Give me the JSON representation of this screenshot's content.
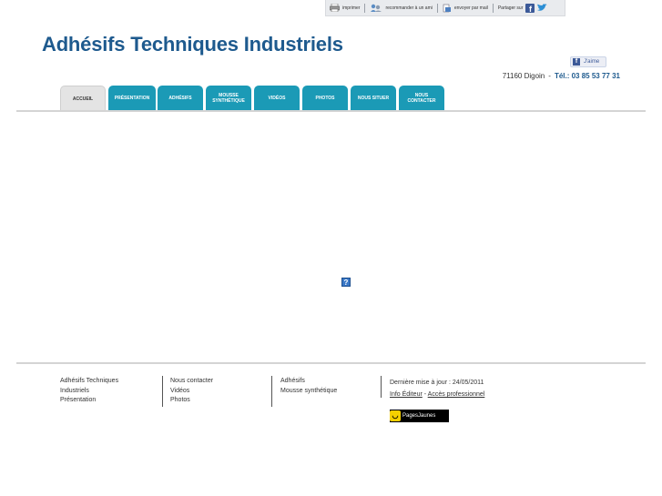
{
  "toolbar": {
    "print_label": "imprimer",
    "recommend_label": "recommander à un ami",
    "email_label": "envoyer par mail",
    "share_label": "Partager sur"
  },
  "header": {
    "title": "Adhésifs Techniques Industriels",
    "like_label": "J'aime",
    "city": "71160 Digoin",
    "separator": "-",
    "phone": "Tél.: 03 85 53 77 31"
  },
  "nav": {
    "tabs": [
      {
        "label": "Accueil"
      },
      {
        "label": "Présentation"
      },
      {
        "label": "Adhésifs"
      },
      {
        "label": "Mousse synthétique"
      },
      {
        "label": "Vidéos"
      },
      {
        "label": "Photos"
      },
      {
        "label": "Nous situer"
      },
      {
        "label": "Nous contacter"
      }
    ]
  },
  "content": {
    "placeholder_glyph": "?"
  },
  "footer": {
    "col1": [
      "Adhésifs Techniques",
      "Industriels",
      "Présentation"
    ],
    "col2": [
      "Nous contacter",
      "Vidéos",
      "Photos"
    ],
    "col3": [
      "Adhésifs",
      "Mousse synthétique"
    ],
    "last_update": "Dernière mise à jour : 24/05/2011",
    "info_editor": "Info Éditeur",
    "link_sep": "-",
    "pro_access": "Accès professionnel",
    "pages_jaunes": "PagesJaunes"
  },
  "colors": {
    "brand": "#1e5a8e",
    "tab": "#1b9ab6"
  }
}
